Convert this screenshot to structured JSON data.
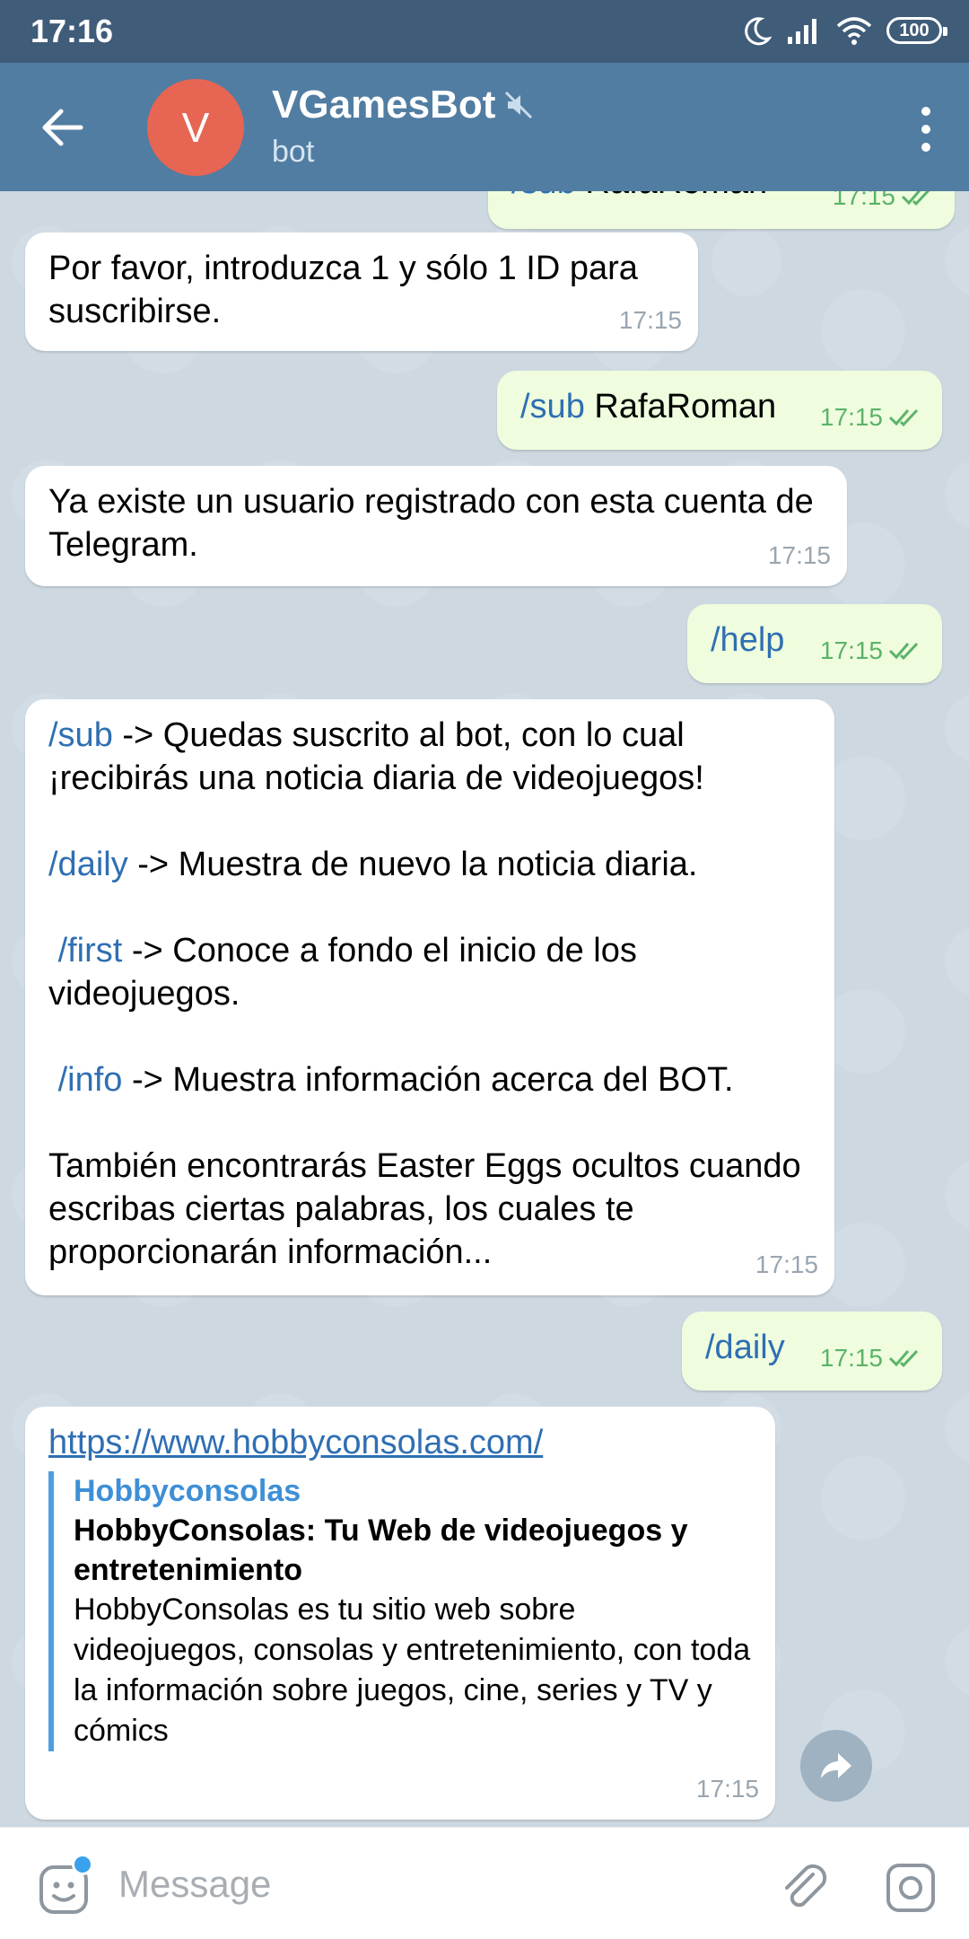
{
  "status": {
    "time": "17:16",
    "battery": "100"
  },
  "header": {
    "avatar_letter": "V",
    "title": "VGamesBot",
    "subtitle": "bot"
  },
  "messages": {
    "top_partial": {
      "cmd": "/sub",
      "text": " RafaRoman",
      "time": "17:15"
    },
    "m1": {
      "text": "Por favor, introduzca 1 y sólo 1 ID para suscribirse.",
      "time": "17:15"
    },
    "m2": {
      "cmd": "/sub",
      "text": " RafaRoman",
      "time": "17:15"
    },
    "m3": {
      "text": "Ya existe un usuario registrado con esta cuenta de Telegram.",
      "time": "17:15"
    },
    "m4": {
      "cmd": "/help",
      "time": "17:15"
    },
    "m5": {
      "sub_cmd": "/sub",
      "sub_text": " -> Quedas suscrito al bot, con lo cual ¡recibirás una noticia diaria de videojuegos!",
      "daily_cmd": "/daily",
      "daily_text": " -> Muestra de nuevo la noticia diaria.",
      "first_cmd": " /first",
      "first_text": " -> Conoce a fondo el inicio de los videojuegos.",
      "info_cmd": " /info",
      "info_text": " -> Muestra información acerca del BOT.",
      "easter": "También encontrarás Easter Eggs ocultos cuando escribas ciertas palabras, los cuales te proporcionarán información...",
      "time": "17:15"
    },
    "m6": {
      "cmd": "/daily",
      "time": "17:15"
    },
    "m7": {
      "url": "https://www.hobbyconsolas.com/",
      "site": "Hobbyconsolas",
      "title": "HobbyConsolas: Tu Web de videojuegos y entretenimiento",
      "description": "HobbyConsolas es tu sitio web sobre videojuegos, consolas y entretenimiento, con toda la información sobre juegos, cine, series y TV y cómics",
      "time": "17:15"
    }
  },
  "input": {
    "placeholder": "Message"
  },
  "icons": {
    "back": "arrow-left-icon",
    "muted": "muted-speaker-icon",
    "menu": "more-vertical-icon",
    "emoji": "sticker-icon",
    "attach": "paperclip-icon",
    "camera": "camera-icon",
    "share": "share-icon"
  },
  "colors": {
    "header": "#517da2",
    "statusbar": "#3f5c79",
    "avatar": "#e76553",
    "outgoing": "#effdde",
    "link": "#2f6fb3",
    "check": "#5bb36a"
  }
}
